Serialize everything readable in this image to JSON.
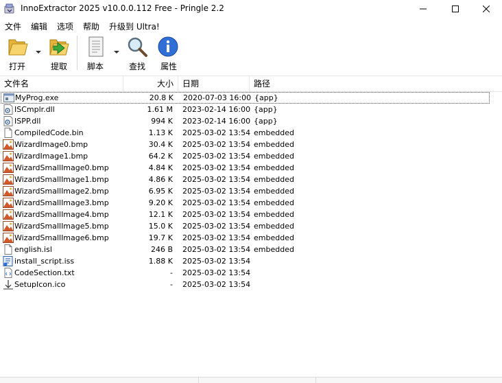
{
  "window": {
    "title": "InnoExtractor 2025 v10.0.0.112 Free - Pringle 2.2"
  },
  "menu": [
    "文件",
    "编辑",
    "选项",
    "帮助",
    "升级到 Ultra!"
  ],
  "toolbar": {
    "open": "打开",
    "extract": "提取",
    "script": "脚本",
    "find": "查找",
    "properties": "属性"
  },
  "columns": {
    "name": "文件名",
    "size": "大小",
    "date": "日期",
    "path": "路径"
  },
  "files": [
    {
      "name": "MyProg.exe",
      "size": "20.8 K",
      "date": "2020-07-03 16:00",
      "path": "{app}",
      "icon": "exe-icon"
    },
    {
      "name": "ISCmplr.dll",
      "size": "1.61 M",
      "date": "2023-02-14 16:00",
      "path": "{app}",
      "icon": "dll-icon"
    },
    {
      "name": "ISPP.dll",
      "size": "994 K",
      "date": "2023-02-14 16:00",
      "path": "{app}",
      "icon": "dll-icon"
    },
    {
      "name": "CompiledCode.bin",
      "size": "1.13 K",
      "date": "2025-03-02 13:54",
      "path": "embedded",
      "icon": "file-icon"
    },
    {
      "name": "WizardImage0.bmp",
      "size": "30.4 K",
      "date": "2025-03-02 13:54",
      "path": "embedded",
      "icon": "image-icon"
    },
    {
      "name": "WizardImage1.bmp",
      "size": "64.2 K",
      "date": "2025-03-02 13:54",
      "path": "embedded",
      "icon": "image-icon"
    },
    {
      "name": "WizardSmallImage0.bmp",
      "size": "4.84 K",
      "date": "2025-03-02 13:54",
      "path": "embedded",
      "icon": "image-icon"
    },
    {
      "name": "WizardSmallImage1.bmp",
      "size": "4.86 K",
      "date": "2025-03-02 13:54",
      "path": "embedded",
      "icon": "image-icon"
    },
    {
      "name": "WizardSmallImage2.bmp",
      "size": "6.95 K",
      "date": "2025-03-02 13:54",
      "path": "embedded",
      "icon": "image-icon"
    },
    {
      "name": "WizardSmallImage3.bmp",
      "size": "9.20 K",
      "date": "2025-03-02 13:54",
      "path": "embedded",
      "icon": "image-icon"
    },
    {
      "name": "WizardSmallImage4.bmp",
      "size": "12.1 K",
      "date": "2025-03-02 13:54",
      "path": "embedded",
      "icon": "image-icon"
    },
    {
      "name": "WizardSmallImage5.bmp",
      "size": "15.0 K",
      "date": "2025-03-02 13:54",
      "path": "embedded",
      "icon": "image-icon"
    },
    {
      "name": "WizardSmallImage6.bmp",
      "size": "19.7 K",
      "date": "2025-03-02 13:54",
      "path": "embedded",
      "icon": "image-icon"
    },
    {
      "name": "english.isl",
      "size": "246 B",
      "date": "2025-03-02 13:54",
      "path": "embedded",
      "icon": "file-icon"
    },
    {
      "name": "install_script.iss",
      "size": "1.88 K",
      "date": "2025-03-02 13:54",
      "path": "",
      "icon": "script-icon"
    },
    {
      "name": "CodeSection.txt",
      "size": "-",
      "date": "2025-03-02 13:54",
      "path": "",
      "icon": "code-icon"
    },
    {
      "name": "SetupIcon.ico",
      "size": "-",
      "date": "2025-03-02 13:54",
      "path": "",
      "icon": "ico-icon"
    }
  ]
}
